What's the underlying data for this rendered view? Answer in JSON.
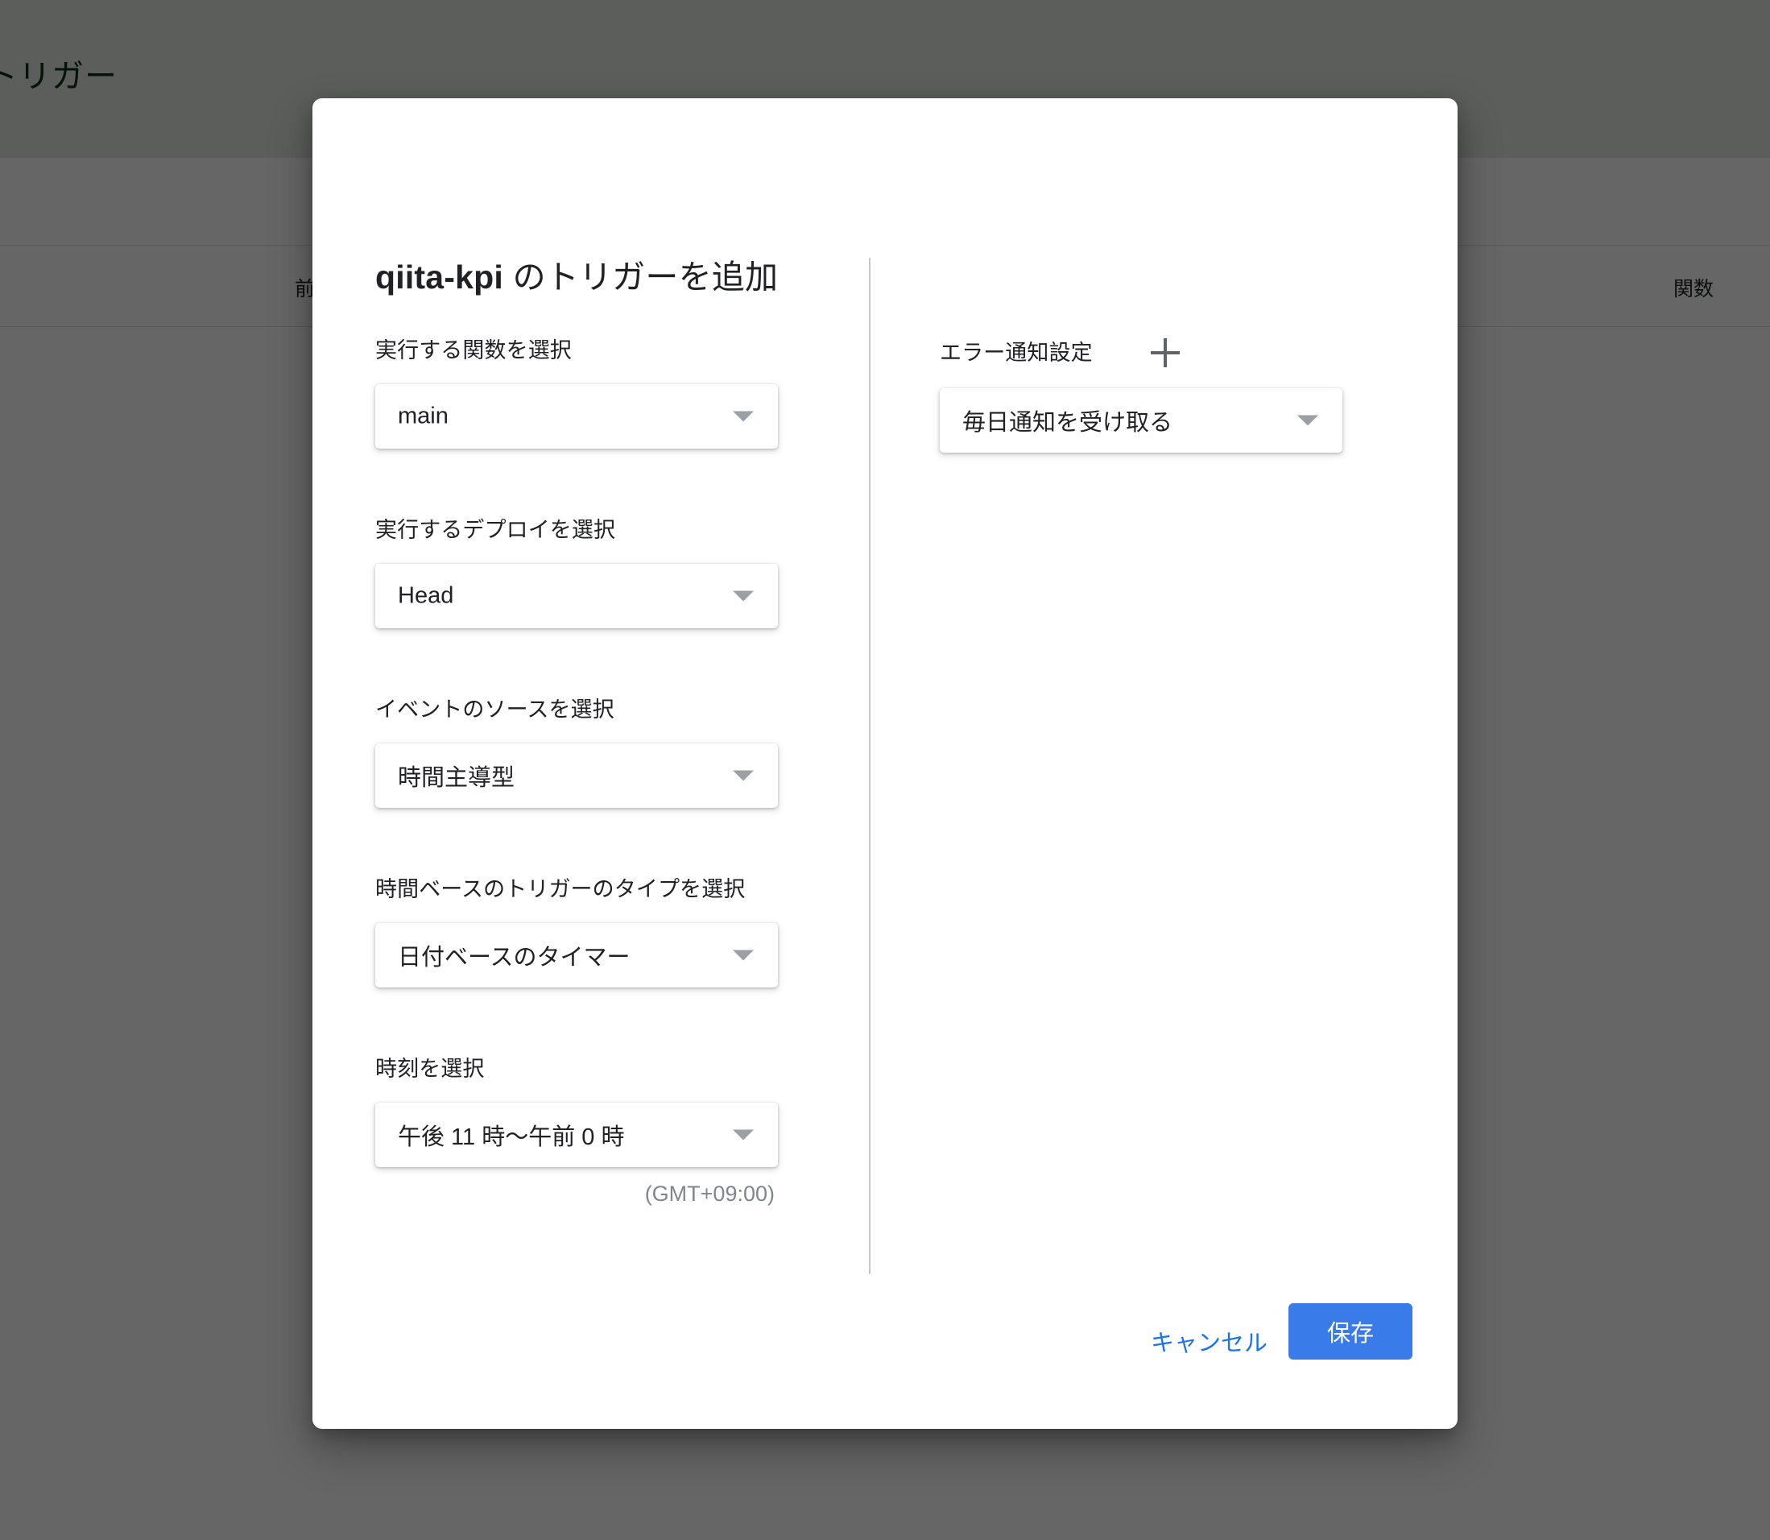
{
  "background": {
    "page_title": "トリガー",
    "table_headers": {
      "previous": "前",
      "function": "関数"
    },
    "blue_fragment": "。"
  },
  "dialog": {
    "title_app": "qiita-kpi",
    "title_rest": " のトリガーを追加",
    "left_column": [
      {
        "label": "実行する関数を選択",
        "value": "main",
        "name": "function"
      },
      {
        "label": "実行するデプロイを選択",
        "value": "Head",
        "name": "deployment"
      },
      {
        "label": "イベントのソースを選択",
        "value": "時間主導型",
        "name": "event-source"
      },
      {
        "label": "時間ベースのトリガーのタイプを選択",
        "value": "日付ベースのタイマー",
        "name": "timer-type"
      },
      {
        "label": "時刻を選択",
        "value": "午後 11 時〜午前 0 時",
        "name": "time-of-day",
        "note": "(GMT+09:00)"
      }
    ],
    "right_column": {
      "label": "エラー通知設定",
      "add_icon": "plus-icon",
      "value": "毎日通知を受け取る"
    },
    "footer": {
      "cancel_label": "キャンセル",
      "save_label": "保存"
    }
  },
  "colors": {
    "accent_blue": "#3a7bea",
    "link_blue": "#1a73e8",
    "header_green": "#e7ece7",
    "title_green": "#0b3312",
    "icon_gray": "#5f6368"
  }
}
